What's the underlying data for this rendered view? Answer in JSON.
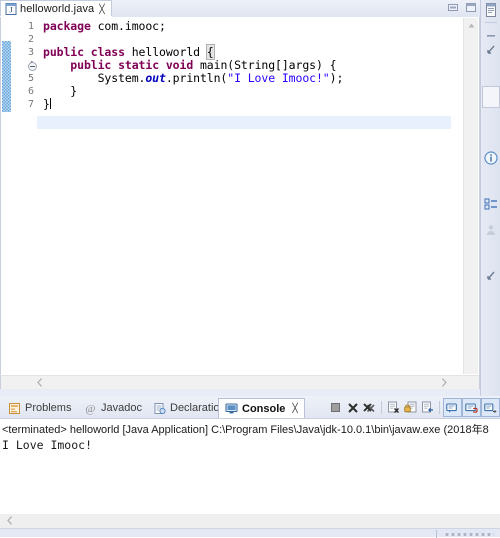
{
  "editor": {
    "tab": {
      "label": "helloworld.java",
      "icon": "java-file-icon",
      "close_glyph": "╳",
      "dirty": false
    },
    "window_controls": [
      {
        "name": "minimize-button",
        "glyph": "minimize-icon"
      },
      {
        "name": "maximize-button",
        "glyph": "maximize-icon"
      }
    ],
    "line_numbers": [
      "1",
      "2",
      "3",
      "4",
      "5",
      "6",
      "7"
    ],
    "fold_marker_line": "4",
    "current_line": 7,
    "code_lines": [
      {
        "n": "1",
        "tokens": [
          {
            "t": "package",
            "c": "kw"
          },
          {
            "t": " com.imooc;",
            "c": "pl"
          }
        ]
      },
      {
        "n": "2",
        "tokens": []
      },
      {
        "n": "3",
        "tokens": [
          {
            "t": "public",
            "c": "kw"
          },
          {
            "t": " ",
            "c": "pl"
          },
          {
            "t": "class",
            "c": "kw"
          },
          {
            "t": " helloworld ",
            "c": "pl"
          },
          {
            "t": "{",
            "c": "brace"
          }
        ]
      },
      {
        "n": "4",
        "tokens": [
          {
            "t": "    ",
            "c": "pl"
          },
          {
            "t": "public",
            "c": "kw"
          },
          {
            "t": " ",
            "c": "pl"
          },
          {
            "t": "static",
            "c": "kw"
          },
          {
            "t": " ",
            "c": "pl"
          },
          {
            "t": "void",
            "c": "kw"
          },
          {
            "t": " main(String[]args) {",
            "c": "pl"
          }
        ]
      },
      {
        "n": "5",
        "tokens": [
          {
            "t": "        System.",
            "c": "pl"
          },
          {
            "t": "out",
            "c": "fld"
          },
          {
            "t": ".println(",
            "c": "pl"
          },
          {
            "t": "\"I Love Imooc!\"",
            "c": "str"
          },
          {
            "t": ");",
            "c": "pl"
          }
        ]
      },
      {
        "n": "6",
        "tokens": [
          {
            "t": "    }",
            "c": "pl"
          }
        ]
      },
      {
        "n": "7",
        "tokens": [
          {
            "t": "}",
            "c": "pl"
          },
          {
            "t": "",
            "c": "caret"
          }
        ]
      }
    ],
    "scroll": {
      "vertical_up_glyph": "▲",
      "horizontal_left_glyph": "‹",
      "horizontal_right_glyph": "›"
    }
  },
  "console_panel": {
    "tabs": [
      {
        "label": "Problems",
        "icon": "problems-icon",
        "active": false
      },
      {
        "label": "Javadoc",
        "icon": "javadoc-at-icon",
        "active": false
      },
      {
        "label": "Declaration",
        "icon": "declaration-icon",
        "active": false
      },
      {
        "label": "Console",
        "icon": "console-icon",
        "active": true,
        "close_glyph": "╳"
      }
    ],
    "toolbar": [
      {
        "name": "terminate-button",
        "icon": "stop-square-icon",
        "enabled": false
      },
      {
        "name": "remove-launch-button",
        "icon": "remove-x-icon",
        "enabled": true
      },
      {
        "name": "remove-all-terminated-button",
        "icon": "remove-all-x-icon",
        "enabled": true
      },
      {
        "name": "clear-console-button",
        "icon": "clear-console-icon",
        "enabled": true
      },
      {
        "name": "scroll-lock-button",
        "icon": "scroll-lock-icon",
        "enabled": true
      },
      {
        "name": "word-wrap-button",
        "icon": "word-wrap-icon",
        "enabled": true
      },
      {
        "name": "pin-console-button",
        "icon": "pin-console-icon",
        "enabled": true,
        "boxed": true
      },
      {
        "name": "display-selected-console-button",
        "icon": "display-console-icon",
        "enabled": true,
        "boxed": true
      },
      {
        "name": "open-console-button",
        "icon": "open-console-icon",
        "enabled": true,
        "boxed": true
      }
    ],
    "output": [
      {
        "text": "<terminated> helloworld [Java Application] C:\\Program Files\\Java\\jdk-10.0.1\\bin\\javaw.exe (2018年8",
        "style": "header"
      },
      {
        "text": "I Love Imooc!",
        "style": "stdout"
      }
    ],
    "scroll_left_glyph": "‹"
  },
  "right_bar": {
    "items": [
      {
        "name": "fastview-package-explorer",
        "icon": "package-explorer-icon"
      },
      {
        "name": "fastview-minimize",
        "icon": "minimize-dash-icon"
      },
      {
        "name": "fastview-restore",
        "icon": "restore-arrow-icon"
      },
      {
        "name": "fastview-empty-slot",
        "icon": "empty-box-icon"
      },
      {
        "name": "fastview-info",
        "icon": "info-circle-icon"
      },
      {
        "name": "fastview-outline",
        "icon": "outline-icon"
      },
      {
        "name": "fastview-person",
        "icon": "person-icon"
      },
      {
        "name": "fastview-restore-2",
        "icon": "restore-arrow-icon"
      }
    ]
  },
  "colors": {
    "keyword": "#7F0055",
    "string": "#2A00FF",
    "field": "#0000C0",
    "plain": "#000000",
    "changebar": "#6AA9E0",
    "current_line": "#E8F0FE",
    "tab_active_bg": "#FFFFFF",
    "chrome": "#E8ECF6"
  }
}
